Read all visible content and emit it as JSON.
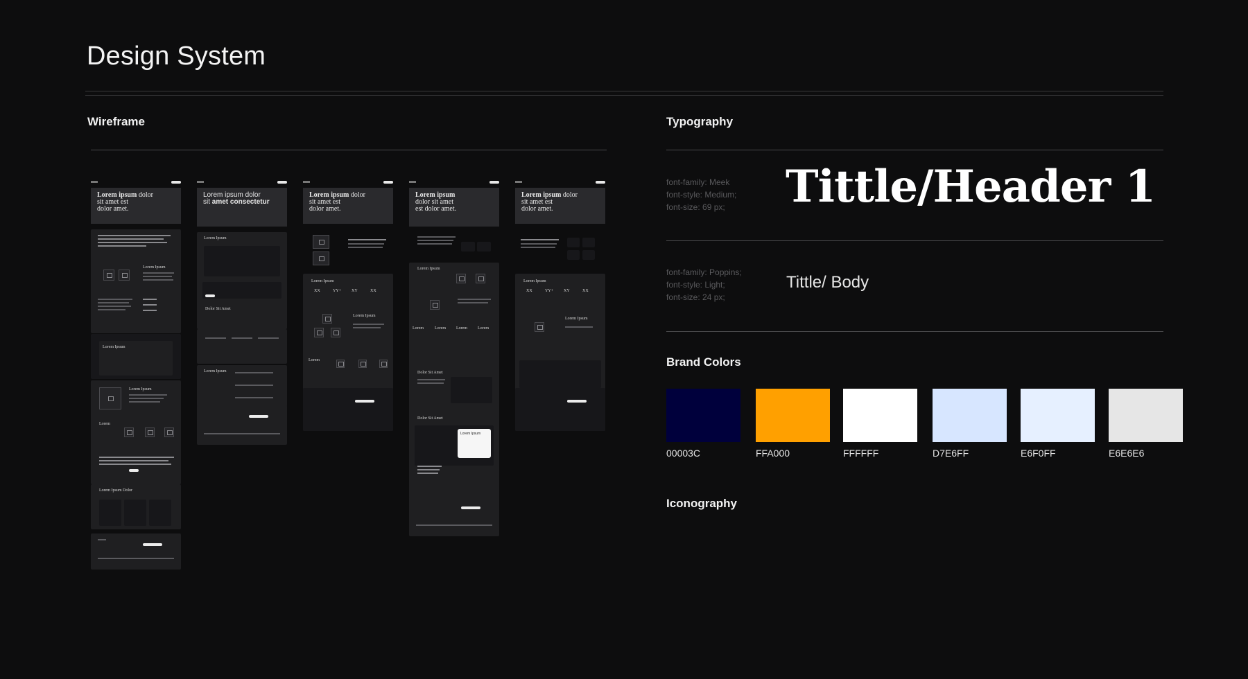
{
  "page": {
    "title": "Design System"
  },
  "wireframe": {
    "label": "Wireframe",
    "screens": [
      {
        "hero": [
          "Lorem ipsum",
          " dolor",
          "sit amet est",
          "dolor amet."
        ]
      },
      {
        "hero": [
          "Lorem ipsum dolor",
          "sit ",
          "amet consectetur"
        ]
      },
      {
        "hero": [
          "Lorem ipsum",
          " dolor",
          "sit amet est",
          "dolor amet."
        ]
      },
      {
        "hero": [
          "Lorem ipsum",
          "dolor sit amet",
          "est dolor amet."
        ]
      },
      {
        "hero": [
          "Lorem ipsum",
          " dolor",
          "sit amet est",
          "dolor amet."
        ]
      }
    ],
    "snippets": {
      "lorem_ipsum": "Lorem Ipsum",
      "lorem_dolor": "Lorem Ipsum Dolor",
      "dolor_sit": "Dolor Sit Amet",
      "stats": [
        "XX",
        "YY+",
        "XY",
        "XX"
      ],
      "lorem": "Lorem"
    }
  },
  "typography": {
    "label": "Typography",
    "styles": [
      {
        "spec": [
          "font-family: Meek",
          "font-style: Medium;",
          "font-size: 69 px;"
        ],
        "sample": "Tittle/Header 1"
      },
      {
        "spec": [
          "font-family: Poppins;",
          "font-style: Light;",
          "font-size: 24 px;"
        ],
        "sample": "Tittle/ Body"
      }
    ]
  },
  "brand_colors": {
    "label": "Brand Colors",
    "swatches": [
      {
        "label": "00003C",
        "hex": "#00003C"
      },
      {
        "label": "FFA000",
        "hex": "#FFA000"
      },
      {
        "label": "FFFFFF",
        "hex": "#FFFFFF"
      },
      {
        "label": "D7E6FF",
        "hex": "#D7E6FF"
      },
      {
        "label": "E6F0FF",
        "hex": "#E6F0FF"
      },
      {
        "label": "E6E6E6",
        "hex": "#E6E6E6"
      }
    ]
  },
  "iconography": {
    "label": "Iconography"
  }
}
